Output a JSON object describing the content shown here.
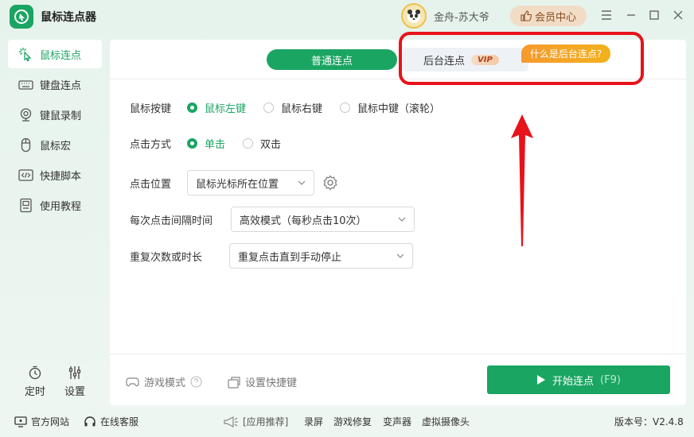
{
  "app": {
    "title": "鼠标连点器"
  },
  "user": {
    "name": "金舟-苏大爷"
  },
  "header": {
    "vip_center": "会员中心"
  },
  "sidebar": {
    "items": [
      {
        "label": "鼠标连点",
        "icon": "cursor-click-icon"
      },
      {
        "label": "键盘连点",
        "icon": "keyboard-icon"
      },
      {
        "label": "键鼠录制",
        "icon": "webcam-icon"
      },
      {
        "label": "鼠标宏",
        "icon": "mouse-icon"
      },
      {
        "label": "快捷脚本",
        "icon": "code-icon"
      },
      {
        "label": "使用教程",
        "icon": "tutorial-icon"
      }
    ],
    "timer_label": "定时",
    "settings_label": "设置"
  },
  "tabs": {
    "normal": "普通连点",
    "background": "后台连点",
    "vip_tag": "VIP",
    "whatis_bubble": "什么是后台连点?"
  },
  "form": {
    "mouse_button": {
      "label": "鼠标按键",
      "options": [
        "鼠标左键",
        "鼠标右键",
        "鼠标中键（滚轮）"
      ],
      "selected": 0
    },
    "click_mode": {
      "label": "点击方式",
      "options": [
        "单击",
        "双击"
      ],
      "selected": 0
    },
    "click_position": {
      "label": "点击位置",
      "value": "鼠标光标所在位置"
    },
    "interval": {
      "label": "每次点击间隔时间",
      "value": "高效模式（每秒点击10次）"
    },
    "repeat": {
      "label": "重复次数或时长",
      "value": "重复点击直到手动停止"
    }
  },
  "footer": {
    "game_mode": "游戏模式",
    "set_hotkey": "设置快捷键",
    "start_button": "开始连点",
    "start_hotkey": "(F9)"
  },
  "statusbar": {
    "official_site": "官方网站",
    "online_service": "在线客服",
    "recommend": "[应用推荐]",
    "links": [
      "录屏",
      "游戏修复",
      "变声器",
      "虚拟摄像头"
    ],
    "version": "版本号：V2.4.8"
  },
  "colors": {
    "accent": "#1aa562",
    "annotation": "#e8121a",
    "bubble": "#f5a623"
  }
}
